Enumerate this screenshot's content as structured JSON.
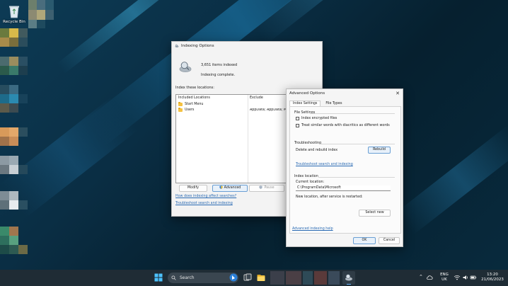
{
  "desktop": {
    "recycle_bin_label": "Recycle Bin"
  },
  "indexing_window": {
    "title": "Indexing Options",
    "items_indexed": "3,651 items indexed",
    "status": "Indexing complete.",
    "locations_label": "Index these locations:",
    "columns": {
      "included": "Included Locations",
      "exclude": "Exclude"
    },
    "rows": [
      {
        "name": "Start Menu",
        "exclude": ""
      },
      {
        "name": "Users",
        "exclude": "AppData; AppData; Micr"
      }
    ],
    "buttons": {
      "modify": "Modify",
      "advanced": "Advanced",
      "pause": "Pause"
    },
    "links": {
      "how_affects": "How does indexing affect searches?",
      "troubleshoot": "Troubleshoot search and indexing"
    }
  },
  "advanced_window": {
    "title": "Advanced Options",
    "tabs": [
      {
        "label": "Index Settings",
        "active": true
      },
      {
        "label": "File Types",
        "active": false
      }
    ],
    "file_settings": {
      "title": "File Settings",
      "options": [
        {
          "label": "Index encrypted files",
          "checked": false
        },
        {
          "label": "Treat similar words with diacritics as different words",
          "checked": false
        }
      ]
    },
    "troubleshooting": {
      "title": "Troubleshooting",
      "delete_rebuild_label": "Delete and rebuild index",
      "rebuild_button": "Rebuild",
      "link": "Troubleshoot search and indexing"
    },
    "index_location": {
      "title": "Index location",
      "current_label": "Current location:",
      "current_value": "C:\\ProgramData\\Microsoft",
      "new_label": "New location, after service is restarted:",
      "select_button": "Select new"
    },
    "help_link": "Advanced indexing help",
    "ok_button": "OK",
    "cancel_button": "Cancel"
  },
  "taskbar": {
    "search_label": "Search",
    "language": "ENG",
    "region": "UK",
    "time": "13:20",
    "date": "21/06/2023"
  },
  "colors": {
    "taskbar": "#1f2c35",
    "link": "#2a6ab3",
    "accent": "#6a9fd4"
  }
}
